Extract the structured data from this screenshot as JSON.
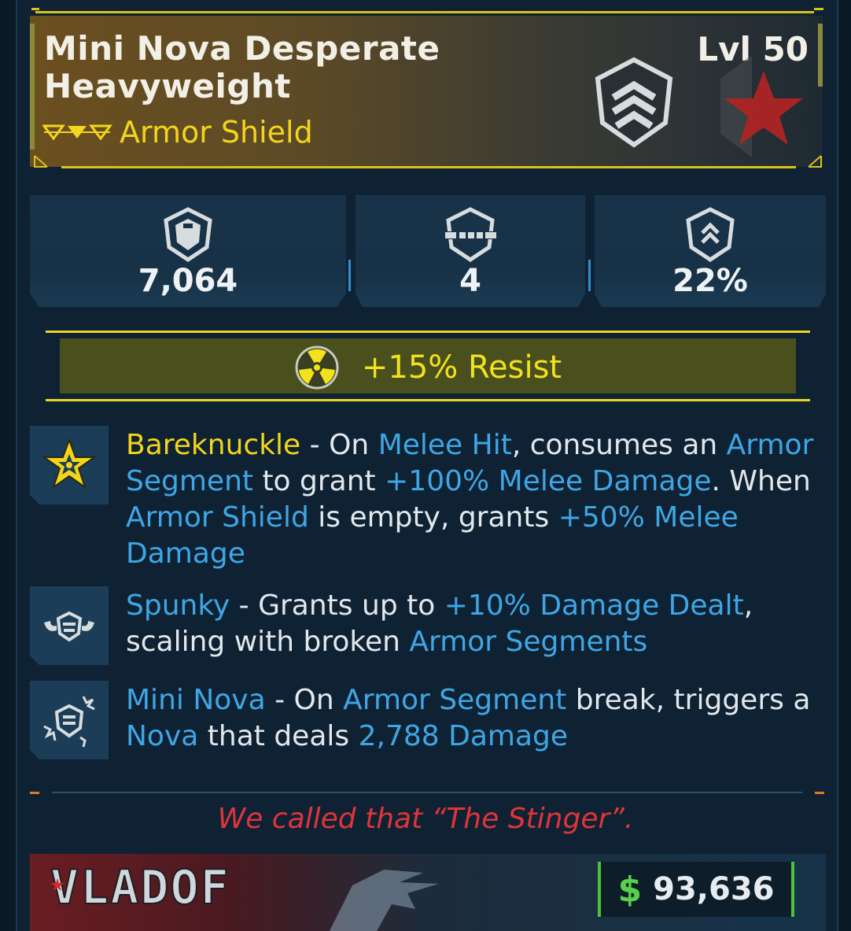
{
  "item": {
    "name": "Mini Nova Desperate Heavyweight",
    "level": "Lvl 50",
    "type": "Armor Shield",
    "rarity_icon": "rarity-chevrons-icon",
    "type_icon": "armor-shield-icon",
    "manufacturer_icon": "vladof-star-emblem"
  },
  "stats": [
    {
      "icon": "shield-capacity-icon",
      "value": "7,064"
    },
    {
      "icon": "armor-segments-icon",
      "value": "4"
    },
    {
      "icon": "recharge-rate-icon",
      "value": "22%"
    }
  ],
  "resist": {
    "icon": "radiation-icon",
    "text": "+15% Resist"
  },
  "perks": [
    {
      "icon": "bareknuckle-star-icon",
      "name": "Bareknuckle",
      "sep": " - ",
      "t1": "On ",
      "h1": "Melee Hit",
      "t2": ", consumes an ",
      "h2": "Armor Segment",
      "t3": " to grant ",
      "h3": "+100% Melee Damage",
      "t4": ". When ",
      "h4": "Armor Shield",
      "t5": " is empty, grants ",
      "h5": "+50% Melee Damage"
    },
    {
      "icon": "spunky-flex-icon",
      "name": "Spunky",
      "sep": " - ",
      "t1": "Grants up to ",
      "h1": "+10% Damage Dealt",
      "t2": ", scaling with broken ",
      "h2": "Armor Segments"
    },
    {
      "icon": "mini-nova-burst-icon",
      "name": "Mini Nova",
      "sep": " - ",
      "t1": "On ",
      "h1": "Armor Segment",
      "t2": " break, triggers a ",
      "h2": "Nova",
      "t3": " that deals ",
      "h3": "2,788 Damage"
    }
  ],
  "flavor": "We called that “The Stinger”.",
  "footer": {
    "manufacturer": "VLADOF",
    "currency_symbol": "$",
    "price": "93,636"
  },
  "colors": {
    "gold": "#f2d51c",
    "blue_highlight": "#3fa6e6",
    "flavor_red": "#e0343a",
    "money_green": "#56d14a"
  }
}
